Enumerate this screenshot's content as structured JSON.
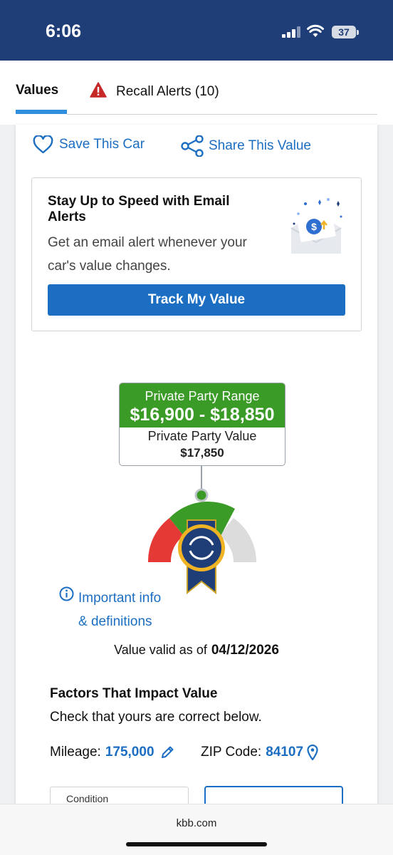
{
  "status_bar": {
    "time": "6:06",
    "battery": "37",
    "background_color": "#1f3e78"
  },
  "tabs": {
    "values_label": "Values",
    "recall_label": "Recall Alerts (10)",
    "active_tab": "Values",
    "alert_icon": "warning-triangle-icon"
  },
  "actions": {
    "save_label": "Save This Car",
    "save_icon": "heart-icon",
    "share_label": "Share This Value",
    "share_icon": "share-icon"
  },
  "email_alert": {
    "title": "Stay Up to Speed with Email Alerts",
    "description": "Get an email alert whenever your car's value changes.",
    "button_label": "Track My Value",
    "illustration_icon": "envelope-dollar-icon"
  },
  "valuation": {
    "range_label": "Private Party Range",
    "range_value": "$16,900 - $18,850",
    "value_label": "Private Party Value",
    "value": "$17,850",
    "accent_green": "#3a9b26"
  },
  "info": {
    "link_line1": "Important info",
    "link_line2": "& definitions",
    "icon": "info-circle-icon"
  },
  "validity": {
    "prefix": "Value valid as of",
    "date": "04/12/2026"
  },
  "factors": {
    "title": "Factors That Impact Value",
    "subtitle": "Check that yours are correct below.",
    "mileage_label": "Mileage:",
    "mileage_value": "175,000",
    "mileage_icon": "pencil-icon",
    "zip_label": "ZIP Code:",
    "zip_value": "84107",
    "zip_icon": "map-pin-icon",
    "condition_label": "Condition"
  },
  "browser": {
    "url": "kbb.com"
  },
  "colors": {
    "link_blue": "#1b6ec2",
    "tab_underline": "#2f8fdc"
  }
}
